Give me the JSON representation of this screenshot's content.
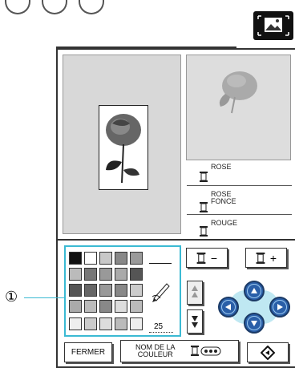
{
  "top_icon": "image-edit-icon",
  "color_list": [
    {
      "name": "ROSE"
    },
    {
      "name": "ROSE\nFONCE"
    },
    {
      "name": "ROUGE"
    }
  ],
  "palette": {
    "size_value": "25"
  },
  "buttons": {
    "minus": "−",
    "plus": "+",
    "close": "FERMER",
    "color_name": "NOM DE LA\nCOULEUR"
  },
  "callout": {
    "label": "①"
  },
  "colors": {
    "accent": "#3bbad3",
    "arrow_blue": "#2a5fa8"
  }
}
